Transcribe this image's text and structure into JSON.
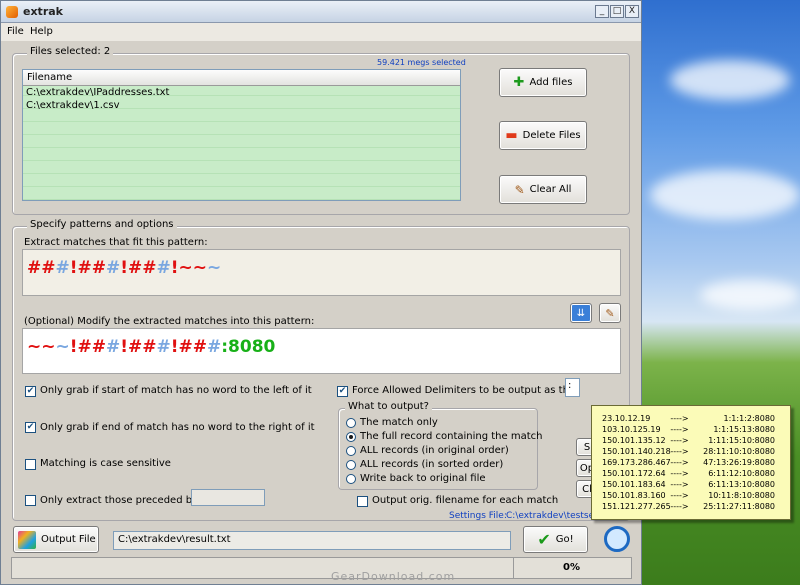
{
  "window": {
    "title": "extrak",
    "controls": [
      "_",
      "□",
      "X"
    ]
  },
  "menu": [
    "File",
    "Help"
  ],
  "files": {
    "group_label": "Files selected: 2",
    "size_info": "59.421 megs selected",
    "column_header": "Filename",
    "rows": [
      "C:\\extrakdev\\IPaddresses.txt",
      "C:\\extrakdev\\1.csv",
      "",
      "",
      "",
      "",
      "",
      "",
      ""
    ],
    "buttons": {
      "add": "Add files",
      "delete": "Delete Files",
      "clear": "Clear All"
    }
  },
  "patterns": {
    "group_label": "Specify patterns and options",
    "extract_label": "Extract matches that fit this pattern:",
    "extract_segments": [
      {
        "t": "##",
        "c": "#e01010"
      },
      {
        "t": "#",
        "c": "#7aa7e0"
      },
      {
        "t": "!##",
        "c": "#e01010"
      },
      {
        "t": "#",
        "c": "#7aa7e0"
      },
      {
        "t": "!##",
        "c": "#e01010"
      },
      {
        "t": "#",
        "c": "#7aa7e0"
      },
      {
        "t": "!~~",
        "c": "#e01010"
      },
      {
        "t": "~",
        "c": "#7aa7e0"
      }
    ],
    "modify_label": "(Optional) Modify the extracted matches into this pattern:",
    "modify_segments": [
      {
        "t": "~~",
        "c": "#e01010"
      },
      {
        "t": "~",
        "c": "#7aa7e0"
      },
      {
        "t": "!##",
        "c": "#e01010"
      },
      {
        "t": "#",
        "c": "#7aa7e0"
      },
      {
        "t": "!##",
        "c": "#e01010"
      },
      {
        "t": "#",
        "c": "#7aa7e0"
      },
      {
        "t": "!##",
        "c": "#e01010"
      },
      {
        "t": "#",
        "c": "#7aa7e0"
      },
      {
        "t": ":8080",
        "c": "#18b018"
      }
    ]
  },
  "options": {
    "no_word_left": "Only grab if start of match has no word to the left of it",
    "no_word_right": "Only grab if end of match has no word to the right of it",
    "case_sensitive": "Matching is case sensitive",
    "preceded_by": "Only extract those preceded by:",
    "force_delim": "Force Allowed Delimiters to be output as this:",
    "delim_value": ":",
    "what_label": "What to output?",
    "radios": [
      "The match only",
      "The full record containing the match",
      "ALL records (in original order)",
      "ALL records (in sorted order)",
      "Write back to original file"
    ],
    "selected_radio": 1,
    "output_filename": "Output orig. filename for each match",
    "settings_label": "Settings File:",
    "settings_value": "C:\\extrakdev\\testsettin"
  },
  "side_buttons": [
    "S",
    "Op",
    "Cl"
  ],
  "tooltip": [
    {
      "ip": "23.10.12.19",
      "arrow": "---->",
      "res": "1:1:1:2:8080"
    },
    {
      "ip": "103.10.125.19",
      "arrow": "---->",
      "res": "1:1:15:13:8080"
    },
    {
      "ip": "150.101.135.12",
      "arrow": "---->",
      "res": "1:11:15:10:8080"
    },
    {
      "ip": "150.101.140.218",
      "arrow": "---->",
      "res": "28:11:10:10:8080"
    },
    {
      "ip": "169.173.286.467",
      "arrow": "---->",
      "res": "47:13:26:19:8080"
    },
    {
      "ip": "150.101.172.64",
      "arrow": "---->",
      "res": "6:11:12:10:8080"
    },
    {
      "ip": "150.101.183.64",
      "arrow": "---->",
      "res": "6:11:13:10:8080"
    },
    {
      "ip": "150.101.83.160",
      "arrow": "---->",
      "res": "10:11:8:10:8080"
    },
    {
      "ip": "151.121.277.265",
      "arrow": "---->",
      "res": "25:11:27:11:8080"
    }
  ],
  "output": {
    "button": "Output File",
    "path": "C:\\extrakdev\\result.txt",
    "go": "Go!"
  },
  "status": {
    "progress": "0%",
    "watermark": "GearDownload.com"
  },
  "colors": {
    "accent": "#1040c0",
    "list_green": "#c8ecc8",
    "tooltip": "#fbfbb8"
  }
}
